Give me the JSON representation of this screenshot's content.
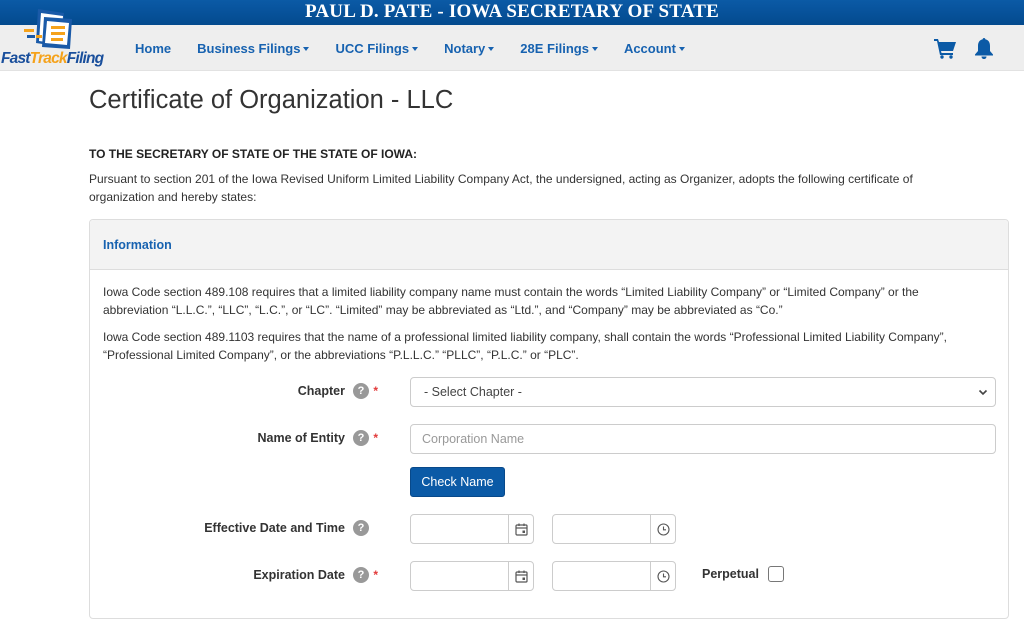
{
  "banner": {
    "title": "PAUL D. PATE - IOWA SECRETARY OF STATE"
  },
  "logo": {
    "part1": "Fast",
    "part2": "Track",
    "part3": "Filing"
  },
  "nav": {
    "items": [
      {
        "label": "Home",
        "dropdown": false
      },
      {
        "label": "Business Filings",
        "dropdown": true
      },
      {
        "label": "UCC Filings",
        "dropdown": true
      },
      {
        "label": "Notary",
        "dropdown": true
      },
      {
        "label": "28E Filings",
        "dropdown": true
      },
      {
        "label": "Account",
        "dropdown": true
      }
    ],
    "icons": [
      "shopping-cart-icon",
      "bell-icon"
    ]
  },
  "page": {
    "title": "Certificate of Organization - LLC",
    "salutation": "TO THE SECRETARY OF STATE OF THE STATE OF IOWA:",
    "intro": "Pursuant to section 201 of the Iowa Revised Uniform Limited Liability Company Act, the undersigned, acting as Organizer, adopts the following certificate of organization and hereby states:"
  },
  "panel": {
    "heading": "Information",
    "notice1": "Iowa Code section 489.108 requires that a limited liability company name must contain the words “Limited Liability Company” or “Limited Company” or the abbreviation “L.L.C.”, “LLC”, “L.C.”, or “LC”. “Limited” may be abbreviated as “Ltd.”, and “Company” may be abbreviated as “Co.”",
    "notice2": "Iowa Code section 489.1103 requires that the name of a professional limited liability company, shall contain the words “Professional Limited Liability Company”, “Professional Limited Company”, or the abbreviations “P.L.L.C.” “PLLC”, “P.L.C.” or “PLC”."
  },
  "form": {
    "chapter": {
      "label": "Chapter",
      "required": true,
      "selected": "- Select Chapter -"
    },
    "entity_name": {
      "label": "Name of Entity",
      "required": true,
      "value": "",
      "placeholder": "Corporation Name"
    },
    "check_name_button": "Check Name",
    "effective": {
      "label": "Effective Date and Time",
      "required": false,
      "date": "",
      "time": ""
    },
    "expiration": {
      "label": "Expiration Date",
      "required": true,
      "date": "",
      "time": ""
    },
    "perpetual": {
      "label": "Perpetual",
      "checked": false
    },
    "help_glyph": "?",
    "required_glyph": "*"
  },
  "colors": {
    "brand_blue": "#0b5aa6",
    "link_blue": "#1762b0",
    "accent_orange": "#f5a21b",
    "required_red": "#e23b3b"
  }
}
